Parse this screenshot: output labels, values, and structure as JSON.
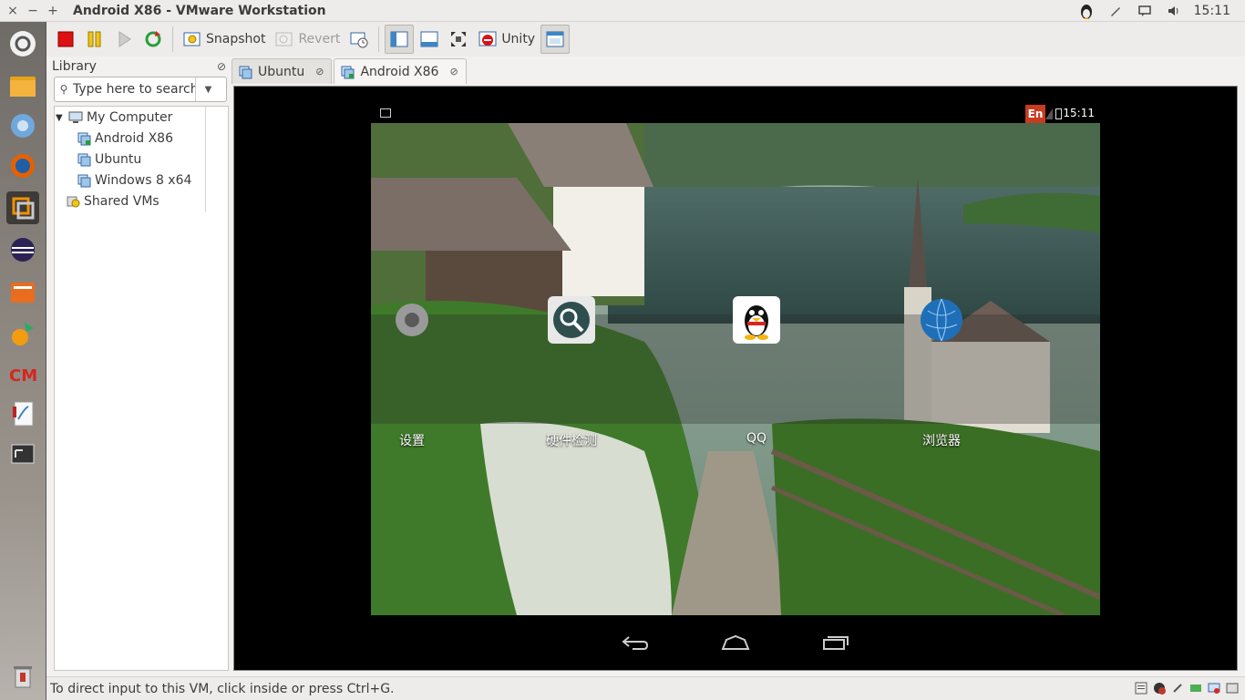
{
  "window": {
    "title": "Android X86 - VMware Workstation",
    "controls": {
      "close": "×",
      "minimize": "−",
      "maximize": "+"
    }
  },
  "topbar": {
    "clock": "15:11"
  },
  "toolbar": {
    "snapshot_label": "Snapshot",
    "revert_label": "Revert",
    "unity_label": "Unity"
  },
  "library": {
    "title": "Library",
    "search_placeholder": "Type here to search",
    "tree": {
      "my_computer": "My Computer",
      "vms": [
        "Android X86",
        "Ubuntu",
        "Windows 8 x64"
      ],
      "shared": "Shared VMs"
    }
  },
  "tabs": [
    "Ubuntu",
    "Android X86"
  ],
  "android": {
    "status_clock": "15:11",
    "ime": "En",
    "apps": [
      "设置",
      "硬件检测",
      "QQ",
      "浏览器"
    ]
  },
  "statusline": {
    "text": "To direct input to this VM, click inside or press Ctrl+G."
  },
  "colors": {
    "accent_red": "#c73b20",
    "launcher": "#7a756f",
    "chrome": "#edecea"
  }
}
